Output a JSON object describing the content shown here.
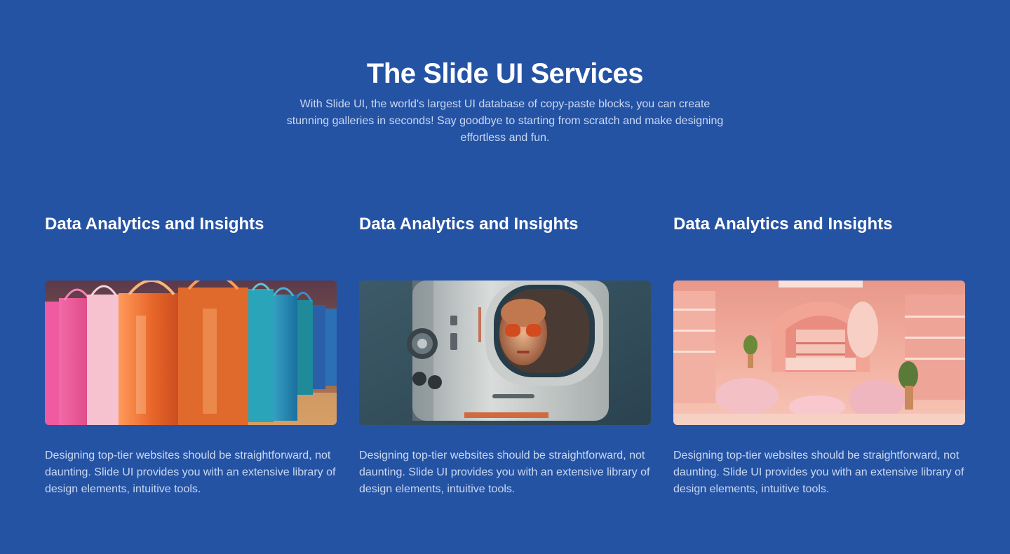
{
  "header": {
    "title": "The Slide UI Services",
    "description": "With Slide UI, the world's largest UI database of copy-paste blocks, you can create stunning galleries in seconds! Say goodbye to starting from scratch and make designing effortless and fun."
  },
  "cards": [
    {
      "title": "Data Analytics and Insights",
      "image": "shopping-bags-photo",
      "text": "Designing top-tier websites should be straightforward, not daunting. Slide UI provides you with an extensive library of design elements, intuitive tools."
    },
    {
      "title": "Data Analytics and Insights",
      "image": "retro-robot-photo",
      "text": "Designing top-tier websites should be straightforward, not daunting. Slide UI provides you with an extensive library of design elements, intuitive tools."
    },
    {
      "title": "Data Analytics and Insights",
      "image": "pink-store-interior-photo",
      "text": "Designing top-tier websites should be straightforward, not daunting. Slide UI provides you with an extensive library of design elements, intuitive tools."
    }
  ],
  "colors": {
    "background": "#2553a4",
    "heading": "#ffffff",
    "body_text": "#c9d8f3"
  }
}
